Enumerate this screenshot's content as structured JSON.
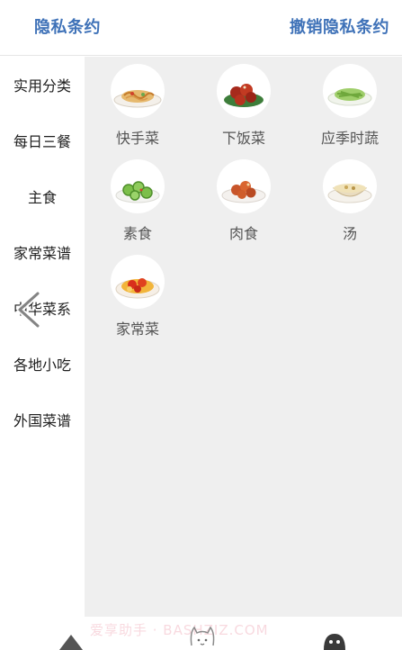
{
  "header": {
    "privacy_label": "隐私条约",
    "revoke_label": "撤销隐私条约"
  },
  "sidebar": {
    "items": [
      {
        "label": "实用分类",
        "active": true
      },
      {
        "label": "每日三餐"
      },
      {
        "label": "主食"
      },
      {
        "label": "家常菜谱"
      },
      {
        "label": "中华菜系"
      },
      {
        "label": "各地小吃"
      },
      {
        "label": "外国菜谱"
      }
    ]
  },
  "categories": [
    {
      "label": "快手菜",
      "icon": "noodle-dish-icon"
    },
    {
      "label": "下饭菜",
      "icon": "braised-pork-dish-icon"
    },
    {
      "label": "应季时蔬",
      "icon": "green-vegetable-dish-icon"
    },
    {
      "label": "素食",
      "icon": "cucumber-dish-icon"
    },
    {
      "label": "肉食",
      "icon": "fried-meat-dish-icon"
    },
    {
      "label": "汤",
      "icon": "soup-bowl-icon"
    },
    {
      "label": "家常菜",
      "icon": "tomato-egg-dish-icon"
    }
  ],
  "watermark": "爱享助手 · BASHZIZ.COM",
  "colors": {
    "accent": "#3f72b8",
    "content_bg": "#efefef"
  }
}
